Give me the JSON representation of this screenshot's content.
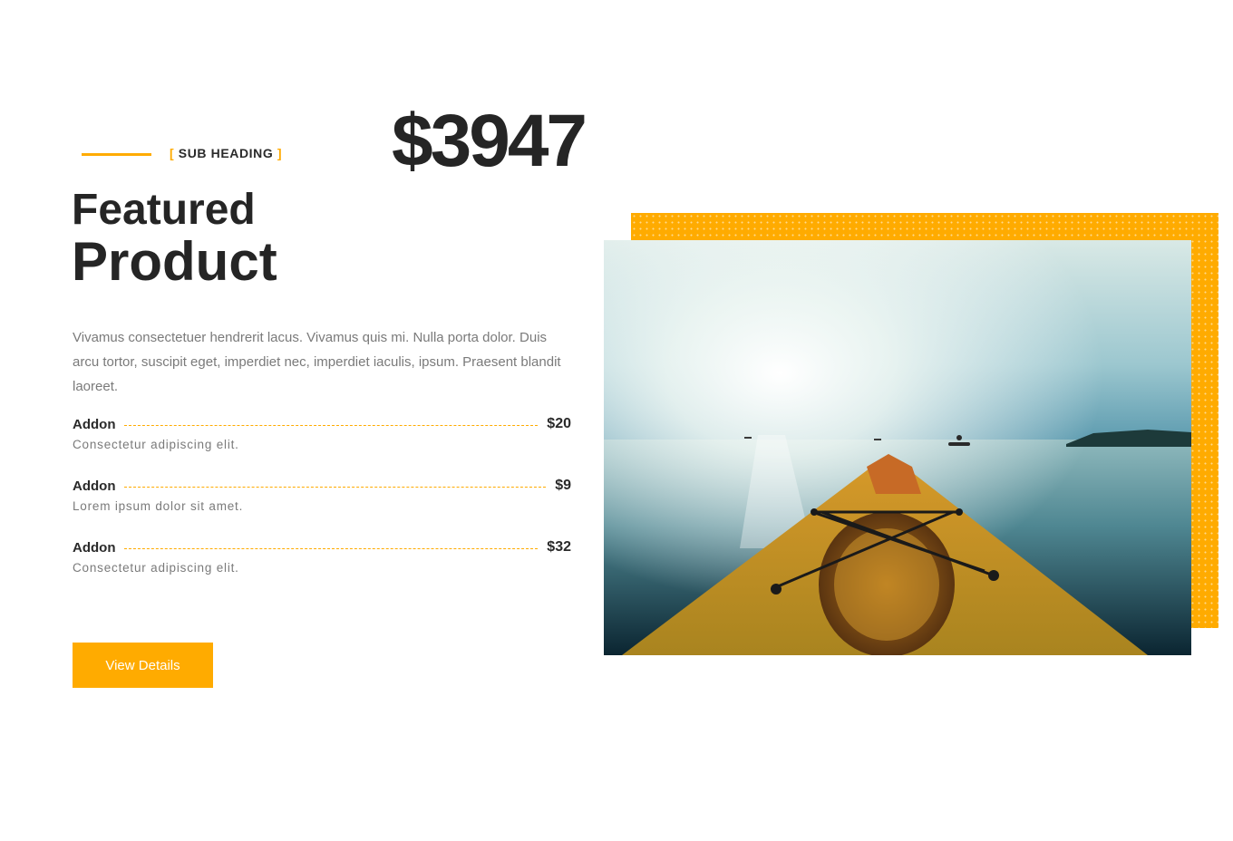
{
  "section": {
    "sub_heading_open": "[",
    "sub_heading": "SUB HEADING",
    "sub_heading_close": "]",
    "price": "$3947",
    "title_line1": "Featured",
    "title_line2": "Product",
    "description": "Vivamus consectetuer hendrerit lacus. Vivamus quis mi. Nulla porta dolor. Duis arcu tortor, suscipit eget, imperdiet nec, imperdiet iaculis, ipsum. Praesent blandit laoreet."
  },
  "addons": [
    {
      "name": "Addon",
      "price": "$20",
      "description": "Consectetur adipiscing elit."
    },
    {
      "name": "Addon",
      "price": "$9",
      "description": "Lorem ipsum dolor sit amet."
    },
    {
      "name": "Addon",
      "price": "$32",
      "description": "Consectetur adipiscing elit."
    }
  ],
  "button": {
    "label": "View Details"
  },
  "colors": {
    "accent": "#ffab00",
    "heading": "#252525",
    "body_text": "#7a7a7a"
  },
  "image": {
    "subject": "kayak-bow-on-sea-photo"
  }
}
